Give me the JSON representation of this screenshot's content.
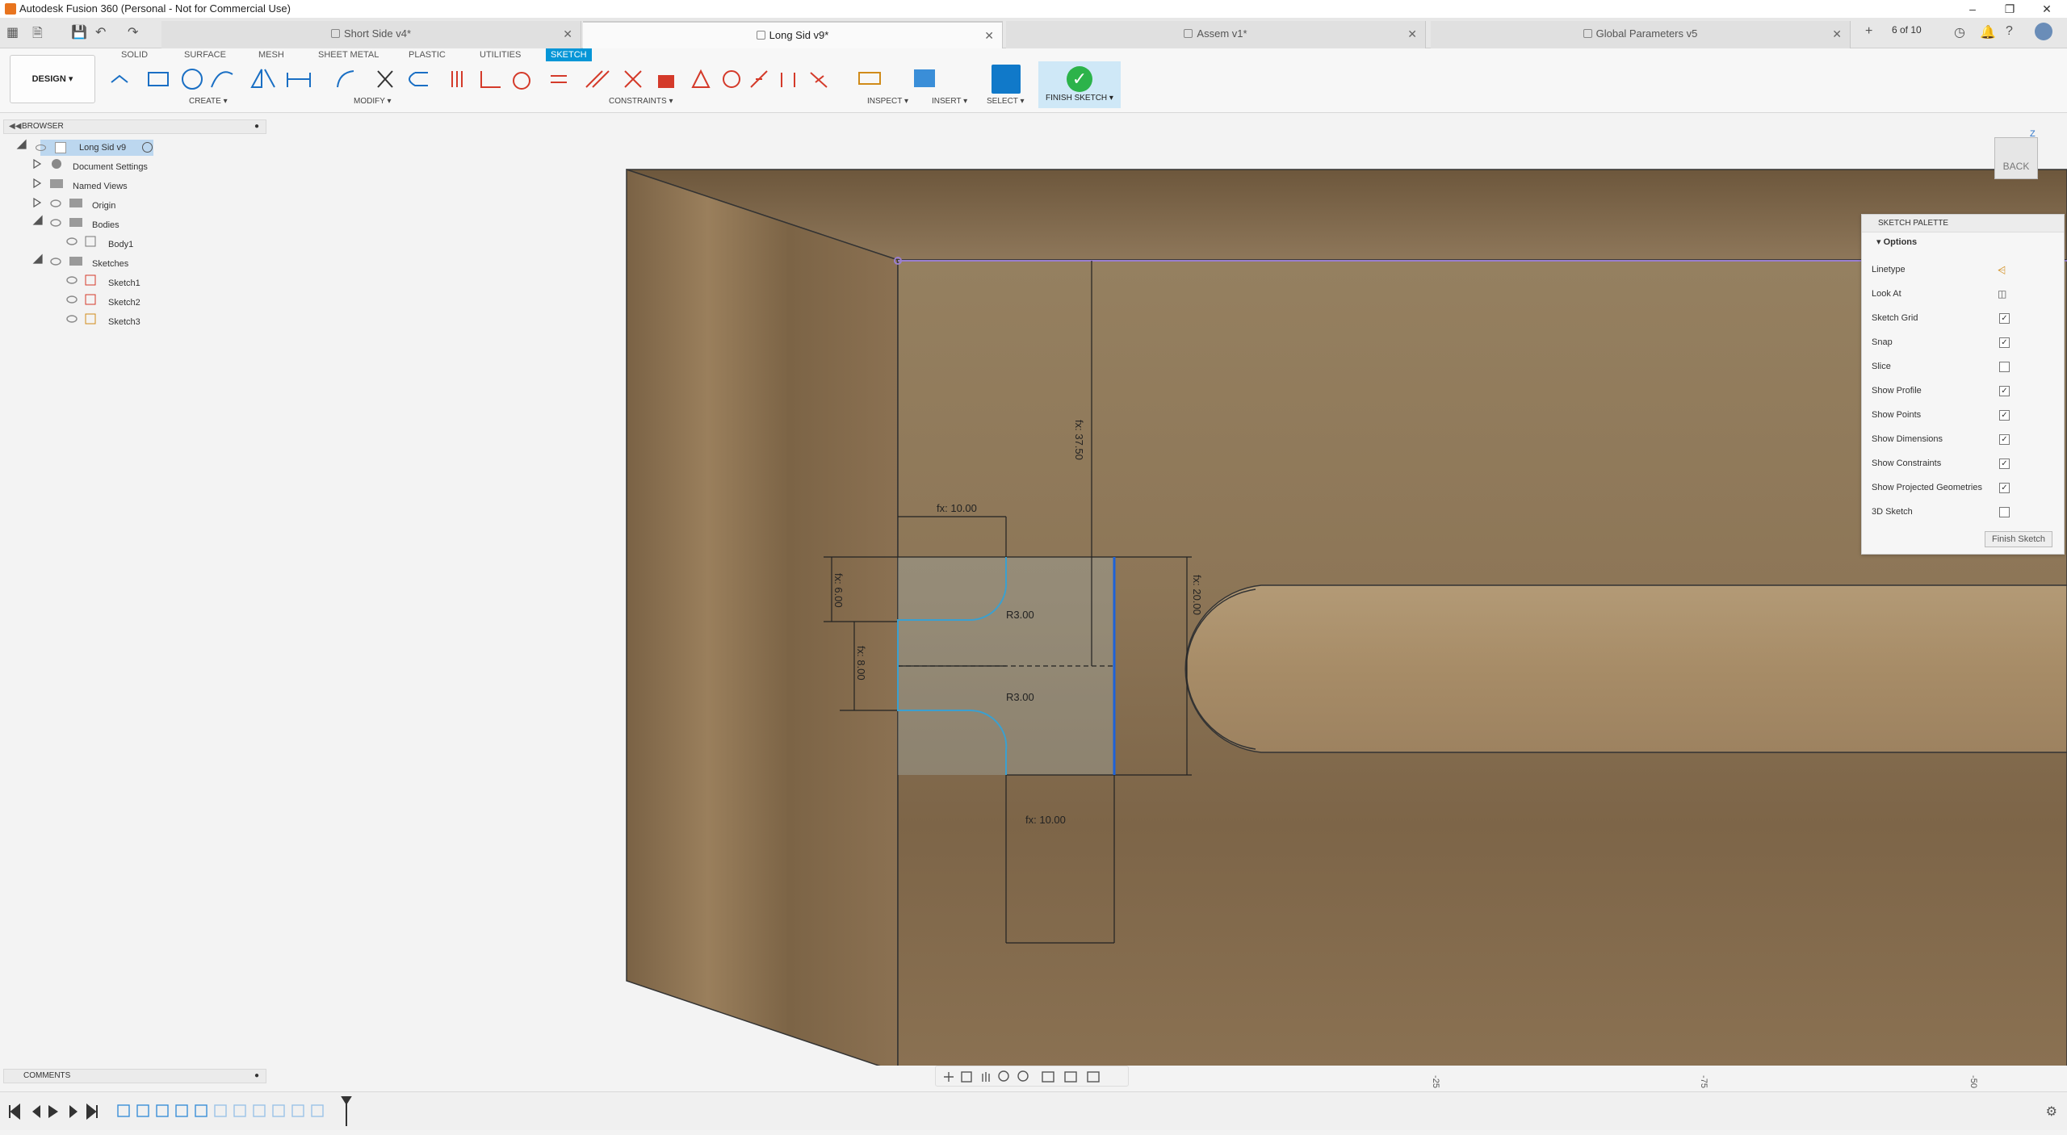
{
  "window": {
    "title": "Autodesk Fusion 360 (Personal - Not for Commercial Use)"
  },
  "tabs": [
    {
      "label": "Short Side v4*"
    },
    {
      "label": "Long Sid v9*"
    },
    {
      "label": "Assem v1*"
    },
    {
      "label": "Global Parameters v5"
    }
  ],
  "tab_count": "6 of 10",
  "toolbar": {
    "workspace": "DESIGN ▾",
    "tabs": [
      "SOLID",
      "SURFACE",
      "MESH",
      "SHEET METAL",
      "PLASTIC",
      "UTILITIES",
      "SKETCH"
    ],
    "groups": [
      "CREATE ▾",
      "MODIFY ▾",
      "CONSTRAINTS ▾",
      "INSPECT ▾",
      "INSERT ▾",
      "SELECT ▾",
      "FINISH SKETCH ▾"
    ]
  },
  "browser": {
    "title": "BROWSER",
    "root": "Long Sid v9",
    "items": [
      "Document Settings",
      "Named Views",
      "Origin",
      "Bodies",
      "Body1",
      "Sketches",
      "Sketch1",
      "Sketch2",
      "Sketch3"
    ]
  },
  "sketch_palette": {
    "title": "SKETCH PALETTE",
    "section": "Options",
    "options": [
      {
        "label": "Linetype",
        "checked": null
      },
      {
        "label": "Look At",
        "checked": null
      },
      {
        "label": "Sketch Grid",
        "checked": true
      },
      {
        "label": "Snap",
        "checked": true
      },
      {
        "label": "Slice",
        "checked": false
      },
      {
        "label": "Show Profile",
        "checked": true
      },
      {
        "label": "Show Points",
        "checked": true
      },
      {
        "label": "Show Dimensions",
        "checked": true
      },
      {
        "label": "Show Constraints",
        "checked": true
      },
      {
        "label": "Show Projected Geometries",
        "checked": true
      },
      {
        "label": "3D Sketch",
        "checked": false
      }
    ],
    "finish_button": "Finish Sketch"
  },
  "dimensions": {
    "top_vertical": "fx: 37.50",
    "top_horizontal": "fx: 10.00",
    "left_small": "fx: 6.00",
    "left_mid": "fx: 8.00",
    "radius_top": "R3.00",
    "radius_bottom": "R3.00",
    "right_vertical": "fx: 20.00",
    "bottom_horizontal": "fx: 10.00"
  },
  "viewcube": {
    "face": "BACK",
    "axis": "Z"
  },
  "comments": {
    "title": "COMMENTS"
  },
  "ruler": [
    "-25",
    "-75",
    "-50"
  ]
}
